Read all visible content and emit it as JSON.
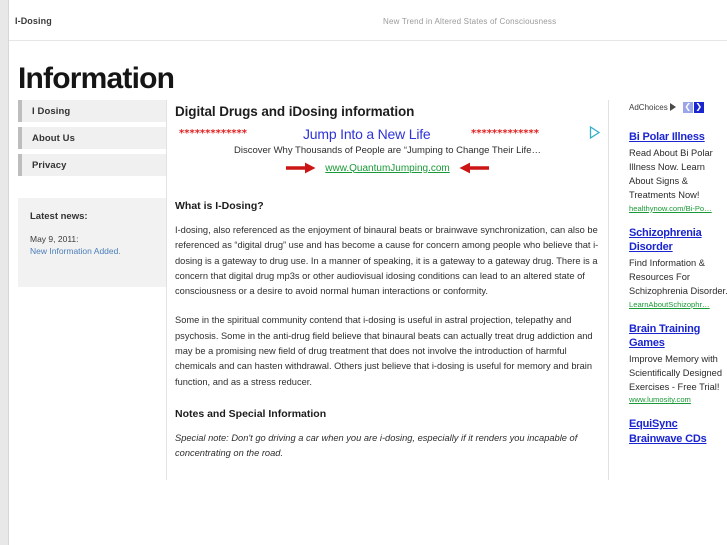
{
  "topbar": {
    "brand": "I-Dosing",
    "tagline": "New Trend in Altered States of Consciousness"
  },
  "masthead": "Information",
  "sidebar": {
    "nav": [
      {
        "label": "I Dosing"
      },
      {
        "label": "About Us"
      },
      {
        "label": "Privacy"
      }
    ],
    "news": {
      "title": "Latest news:",
      "date": "May 9, 2011:",
      "link": "New Information Added."
    }
  },
  "main": {
    "title": "Digital Drugs and iDosing information",
    "inline_ad": {
      "stars_left": "*************",
      "stars_right": "*************",
      "headline": "Jump Into a New Life",
      "subline": "Discover Why Thousands of People are “Jumping to Change Their Life…",
      "url": "www.QuantumJumping.com",
      "left_arrow_icon": "right-arrow-icon",
      "right_arrow_icon": "left-arrow-icon",
      "info_icon": "adchoices-triangle-icon"
    },
    "sections": [
      {
        "heading": "What is I-Dosing?",
        "paragraphs": [
          "I-dosing, also referenced as the enjoyment of binaural beats or brainwave synchronization, can also be referenced as “digital drug” use and has become a cause for concern among people who believe that i-dosing is a gateway to drug use. In a manner of speaking, it is a gateway to a gateway drug. There is a concern that digital drug mp3s or other audiovisual idosing conditions can lead to an altered state of consciousness or a desire to avoid normal human interactions or conformity.",
          "Some in the spiritual community contend that i-dosing is useful in astral projection, telepathy and psychosis. Some in the anti-drug field believe that binaural beats can actually treat drug addiction and may be a promising new field of drug treatment that does not involve the introduction of harmful chemicals and can hasten withdrawal. Others just believe that i-dosing is useful for memory and brain function, and as a stress reducer."
        ]
      }
    ],
    "notes": {
      "heading": "Notes and Special Information",
      "text": "Special note: Don't go driving a car when you are i-dosing, especially if it renders you incapable of concentrating on the road."
    }
  },
  "ads": {
    "adchoices_label": "AdChoices",
    "prev_glyph": "❮",
    "next_glyph": "❯",
    "units": [
      {
        "title": "Bi Polar Illness",
        "body": "Read About Bi Polar Illness Now. Learn About Signs & Treatments Now!",
        "domain": "healthynow.com/Bi-Po…"
      },
      {
        "title": "Schizophrenia Disorder",
        "body": "Find Information & Resources For Schizophrenia Disorder.",
        "domain": "LearnAboutSchizophr…"
      },
      {
        "title": "Brain Training Games",
        "body": "Improve Memory with Scientifically Designed Exercises - Free Trial!",
        "domain": "www.lumosity.com"
      },
      {
        "title": "EquiSync Brainwave CDs",
        "body": "",
        "domain": ""
      }
    ]
  },
  "colors": {
    "link_blue": "#1a25d0",
    "news_blue": "#4a7ebb",
    "ad_green": "#1a9a36",
    "star_red": "#e02020",
    "headline_blue": "#2f34d8"
  }
}
